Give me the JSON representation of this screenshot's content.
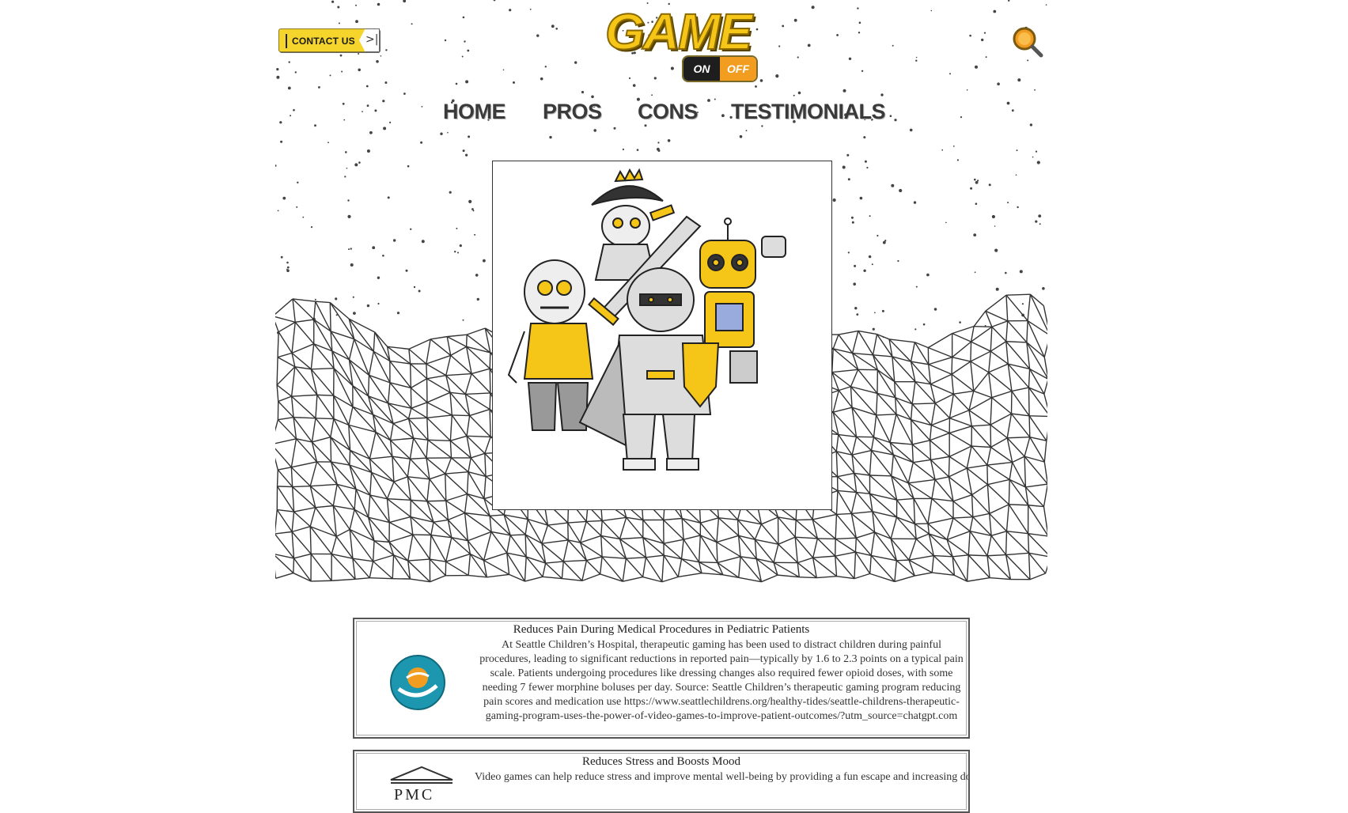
{
  "header": {
    "contact_label": "CONTACT US",
    "contact_arrow": ">|",
    "logo_word": "GAME",
    "logo_on": "ON",
    "logo_off": "OFF",
    "search_icon": "search-icon"
  },
  "nav": {
    "items": [
      {
        "label": "HOME"
      },
      {
        "label": "PROS"
      },
      {
        "label": "CONS"
      },
      {
        "label": "TESTIMONIALS"
      }
    ]
  },
  "hero": {
    "image": "characters-illustration",
    "characters": [
      "pirate",
      "zombie",
      "knight",
      "robot"
    ]
  },
  "cards": [
    {
      "title": "Reduces Pain During Medical Procedures in Pediatric Patients",
      "body": "At Seattle Children’s Hospital, therapeutic gaming has been used to distract children during painful procedures, leading to significant reductions in reported pain—typically by 1.6 to 2.3 points on a typical pain scale. Patients undergoing procedures like dressing changes also required fewer opioid doses, with some needing 7 fewer morphine boluses per day. Source: Seattle Children’s therapeutic gaming program reducing pain scores and medication use https://www.seattlechildrens.org/healthy-tides/seattle-childrens-therapeutic-gaming-program-uses-the-power-of-video-games-to-improve-patient-outcomes/?utm_source=chatgpt.com",
      "logo": "hospital-logo"
    },
    {
      "title": "Reduces Stress and Boosts Mood",
      "body": "Video games can help reduce stress and improve mental well-being by providing a fun escape and increasing dopamine levels. Casual or relaxing games especially help players unwind after a",
      "logo_text": "PMC",
      "logo": "pmc-logo"
    }
  ],
  "colors": {
    "accent": "#f5c518",
    "orange": "#f29d1f",
    "text": "#333333"
  }
}
